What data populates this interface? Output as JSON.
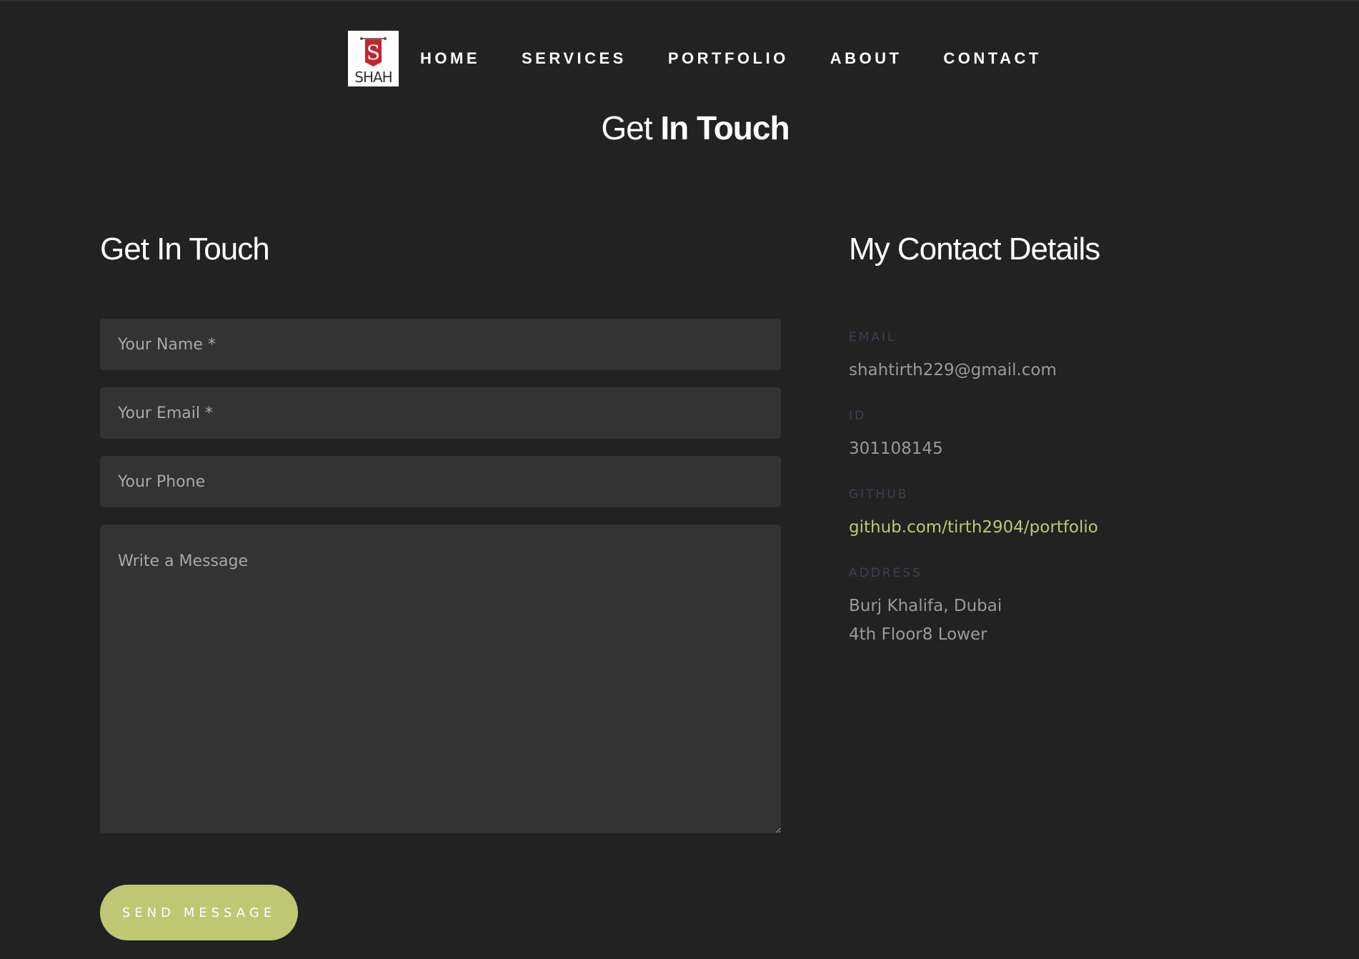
{
  "colors": {
    "background": "#222222",
    "field": "#333333",
    "accent": "#bfc773",
    "label": "#3b4251",
    "muted": "#9a9a9a"
  },
  "nav": {
    "logo_text": "SHAH",
    "logo_letter": "S",
    "items": [
      "HOME",
      "SERVICES",
      "PORTFOLIO",
      "ABOUT",
      "CONTACT"
    ]
  },
  "hero": {
    "title_light": "Get",
    "title_bold": "In Touch"
  },
  "form": {
    "heading": "Get In Touch",
    "name_placeholder": "Your Name *",
    "email_placeholder": "Your Email *",
    "phone_placeholder": "Your Phone",
    "message_placeholder": "Write a Message",
    "submit_label": "SEND MESSAGE"
  },
  "contact": {
    "heading": "My Contact Details",
    "email_label": "EMAIL",
    "email_value": "shahtirth229@gmail.com",
    "id_label": "ID",
    "id_value": "301108145",
    "github_label": "GITHUB",
    "github_value": "github.com/tirth2904/portfolio",
    "address_label": "ADDRESS",
    "address_line1": "Burj Khalifa, Dubai",
    "address_line2": "4th Floor8 Lower"
  }
}
